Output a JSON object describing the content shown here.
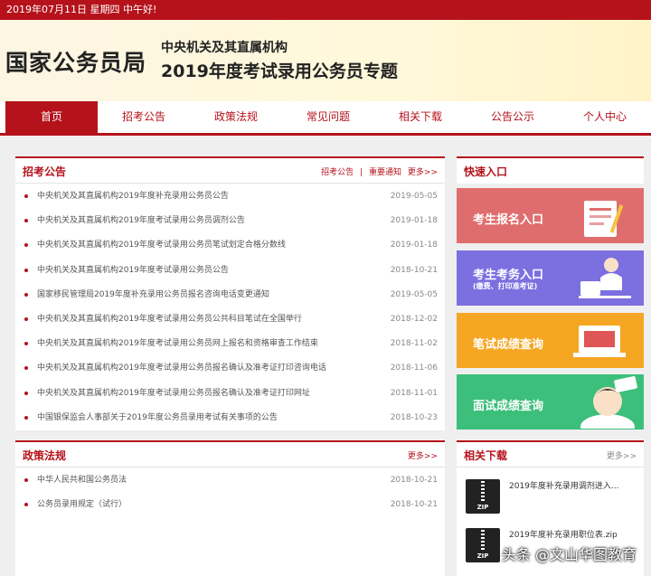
{
  "topbar": {
    "text": "2019年07月11日  星期四  中午好!"
  },
  "header": {
    "site_name": "国家公务员局",
    "subtitle1": "中央机关及其直属机构",
    "subtitle2": "2019年度考试录用公务员专题"
  },
  "nav": {
    "items": [
      {
        "label": "首页"
      },
      {
        "label": "招考公告"
      },
      {
        "label": "政策法规"
      },
      {
        "label": "常见问题"
      },
      {
        "label": "相关下载"
      },
      {
        "label": "公告公示"
      },
      {
        "label": "个人中心"
      }
    ]
  },
  "announcements": {
    "title": "招考公告",
    "link1": "招考公告",
    "separator": "|",
    "link2": "重要通知",
    "more": "更多>>",
    "items": [
      {
        "text": "中央机关及其直属机构2019年度补充录用公务员公告",
        "date": "2019-05-05"
      },
      {
        "text": "中央机关及其直属机构2019年度考试录用公务员调剂公告",
        "date": "2019-01-18"
      },
      {
        "text": "中央机关及其直属机构2019年度考试录用公务员笔试划定合格分数线",
        "date": "2019-01-18"
      },
      {
        "text": "中央机关及其直属机构2019年度考试录用公务员公告",
        "date": "2018-10-21"
      },
      {
        "text": "国家移民管理局2019年度补充录用公务员报名咨询电话变更通知",
        "date": "2019-05-05"
      },
      {
        "text": "中央机关及其直属机构2019年度考试录用公务员公共科目笔试在全国举行",
        "date": "2018-12-02"
      },
      {
        "text": "中央机关及其直属机构2019年度考试录用公务员网上报名和资格审查工作结束",
        "date": "2018-11-02"
      },
      {
        "text": "中央机关及其直属机构2019年度考试录用公务员报名确认及准考证打印咨询电话",
        "date": "2018-11-06"
      },
      {
        "text": "中央机关及其直属机构2019年度考试录用公务员报名确认及准考证打印网址",
        "date": "2018-11-01"
      },
      {
        "text": "中国银保监会人事部关于2019年度公务员录用考试有关事项的公告",
        "date": "2018-10-23"
      }
    ]
  },
  "policy": {
    "title": "政策法规",
    "more": "更多>>",
    "items": [
      {
        "text": "中华人民共和国公务员法",
        "date": "2018-10-21"
      },
      {
        "text": "公务员录用规定（试行）",
        "date": "2018-10-21"
      }
    ]
  },
  "quick_entry": {
    "title": "快速入口",
    "buttons": [
      {
        "label": "考生报名入口",
        "sub": "",
        "color": "#e06d6d"
      },
      {
        "label": "考生考务入口",
        "sub": "(缴费、打印准考证)",
        "color": "#7c6fe0"
      },
      {
        "label": "笔试成绩查询",
        "sub": "",
        "color": "#f5a623"
      },
      {
        "label": "面试成绩查询",
        "sub": "",
        "color": "#3cbf7a"
      }
    ]
  },
  "downloads": {
    "title": "相关下载",
    "more": "更多>>",
    "items": [
      {
        "name": "2019年度补充录用调剂进入...",
        "icon_label": "ZIP"
      },
      {
        "name": "2019年度补充录用职位表.zip",
        "icon_label": "ZIP"
      }
    ]
  },
  "watermark": {
    "text": "头条 @文山华图教育"
  }
}
